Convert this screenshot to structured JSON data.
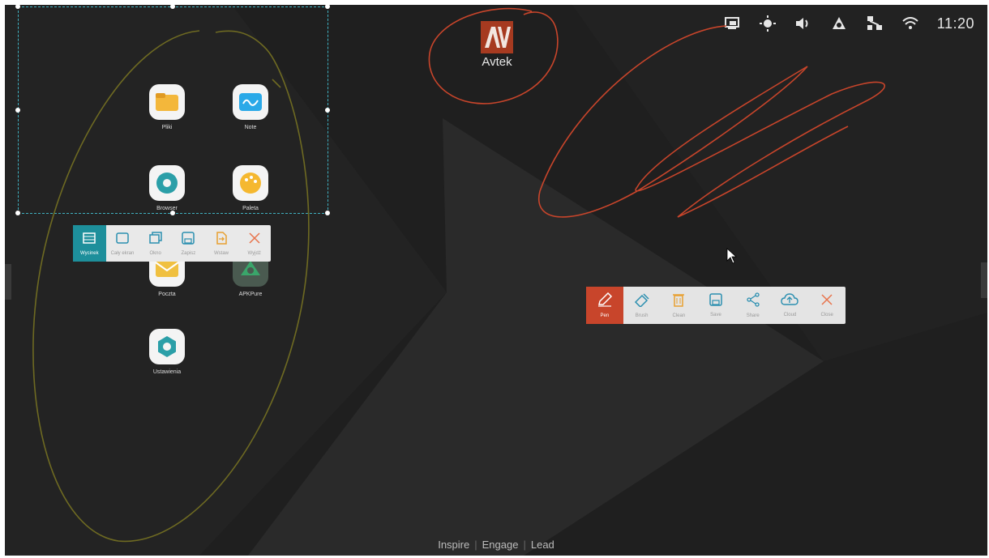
{
  "status_bar": {
    "icons": [
      "screen-mirror-icon",
      "brightness-icon",
      "volume-icon",
      "cast-icon",
      "network-icon",
      "wifi-icon"
    ],
    "time": "11:20"
  },
  "logo": {
    "mark": "AV",
    "brand": "Avtek",
    "color": "#a63a20"
  },
  "apps": [
    {
      "label": "Pliki",
      "icon": "folder-icon",
      "color": "#f3b73b"
    },
    {
      "label": "Note",
      "icon": "note-icon",
      "color": "#2aa9e8"
    },
    {
      "label": "Browser",
      "icon": "browser-icon",
      "color": "#2b9fa8"
    },
    {
      "label": "Paleta",
      "icon": "palette-icon",
      "color": "#f5b830"
    },
    {
      "label": "Poczta",
      "icon": "mail-icon",
      "color": "#f0c040"
    },
    {
      "label": "APKPure",
      "icon": "apkpure-icon",
      "color": "#3aa56a"
    },
    {
      "label": "Ustawienia",
      "icon": "settings-icon",
      "color": "#2b9fa8"
    }
  ],
  "screenshot_toolbar": {
    "items": [
      {
        "label": "Wycinek",
        "icon": "crop-icon",
        "active": true
      },
      {
        "label": "Cały ekran",
        "icon": "fullscreen-icon",
        "active": false
      },
      {
        "label": "Okno",
        "icon": "window-icon",
        "active": false
      },
      {
        "label": "Zapisz",
        "icon": "save-icon",
        "active": false
      },
      {
        "label": "Wstaw",
        "icon": "insert-icon",
        "active": false
      },
      {
        "label": "Wyjdź",
        "icon": "close-icon",
        "active": false
      }
    ],
    "accent": "#1d8f9b"
  },
  "pen_toolbar": {
    "items": [
      {
        "label": "Pen",
        "icon": "pen-icon",
        "active": true
      },
      {
        "label": "Brush",
        "icon": "brush-icon",
        "active": false
      },
      {
        "label": "Clean",
        "icon": "trash-icon",
        "active": false
      },
      {
        "label": "Save",
        "icon": "save-icon",
        "active": false
      },
      {
        "label": "Share",
        "icon": "share-icon",
        "active": false
      },
      {
        "label": "Cloud",
        "icon": "cloud-icon",
        "active": false
      },
      {
        "label": "Close",
        "icon": "close-icon",
        "active": false
      }
    ],
    "accent": "#c8452b"
  },
  "footer": {
    "items": [
      "Inspire",
      "Engage",
      "Lead"
    ]
  },
  "colors": {
    "background": "#1f1f1f",
    "ink_red": "#c8452b",
    "ink_olive": "#6e6a22",
    "selection": "#3fb0c0"
  }
}
